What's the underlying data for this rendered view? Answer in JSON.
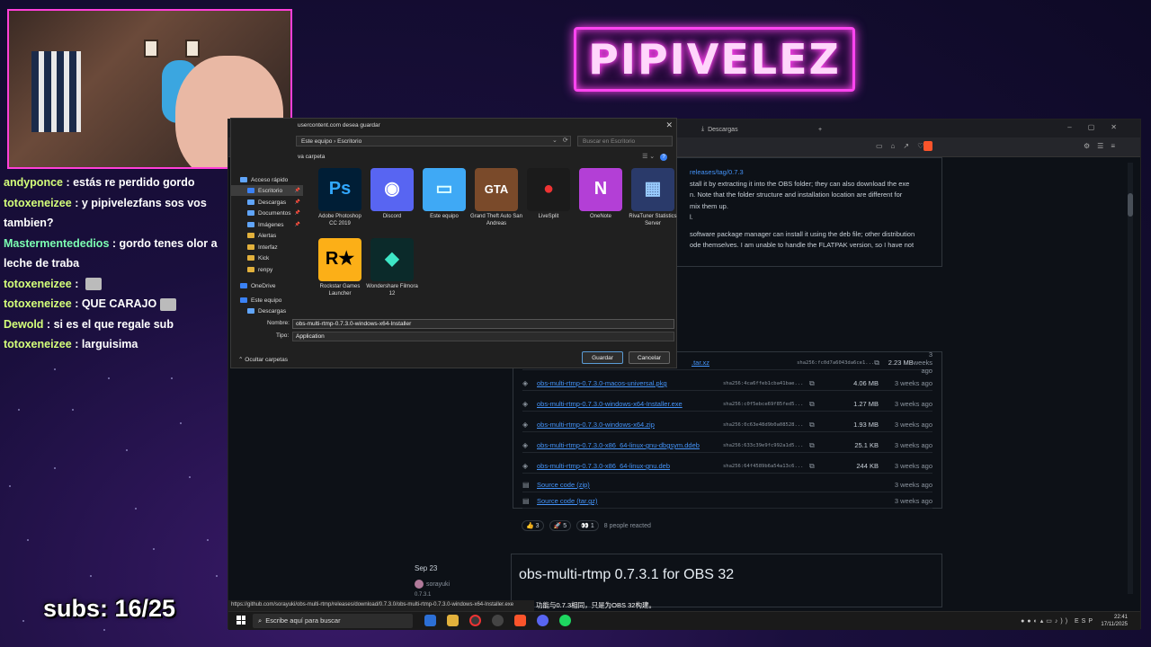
{
  "overlay": {
    "channel_name": "PIPIVELEZ",
    "subs_counter": "subs: 16/25"
  },
  "chat": [
    {
      "user": "andyponce",
      "color": "#d4ff7a",
      "text": "estás re perdido gordo"
    },
    {
      "user": "totoxeneizee",
      "color": "#d4ff7a",
      "text": "y pipivelezfans sos vos tambien?"
    },
    {
      "user": "Mastermentededios",
      "color": "#7cffb2",
      "text": "gordo tenes olor a leche de traba"
    },
    {
      "user": "totoxeneizee",
      "color": "#d4ff7a",
      "text": ""
    },
    {
      "user": "totoxeneizee",
      "color": "#d4ff7a",
      "text": "QUE CARAJO"
    },
    {
      "user": "Dewold",
      "color": "#d4ff7a",
      "text": "si es el que regale sub"
    },
    {
      "user": "totoxeneizee",
      "color": "#d4ff7a",
      "text": "larguisima"
    }
  ],
  "browser": {
    "tab_label": "Descargas",
    "release_link": "releases/tag/0.7.3",
    "notes": [
      "stall it by extracting it into the OBS folder; they can also download the exe",
      "n. Note that the folder structure and installation location are different for",
      "mix them up.",
      "l.",
      "software package manager can install it using the deb file; other distribution",
      "ode themselves. I am unable to handle the FLATPAK version, so I have not"
    ],
    "assets": [
      {
        "name": ".tar.xz",
        "sha": "sha256:fc0d7a6043da6ce1...",
        "size": "2.23 MB",
        "age": "3 weeks ago"
      },
      {
        "name": "obs-multi-rtmp-0.7.3.0-macos-universal.pkg",
        "sha": "sha256:4ca6ffeb1cba41bae...",
        "size": "4.06 MB",
        "age": "3 weeks ago"
      },
      {
        "name": "obs-multi-rtmp-0.7.3.0-windows-x64-Installer.exe",
        "sha": "sha256:c0f5ebce69f85fed5...",
        "size": "1.27 MB",
        "age": "3 weeks ago"
      },
      {
        "name": "obs-multi-rtmp-0.7.3.0-windows-x64.zip",
        "sha": "sha256:0c63e48d9b0a08528...",
        "size": "1.93 MB",
        "age": "3 weeks ago"
      },
      {
        "name": "obs-multi-rtmp-0.7.3.0-x86_64-linux-gnu-dbgsym.ddeb",
        "sha": "sha256:633c39e9fc992a1d5...",
        "size": "25.1 KB",
        "age": "3 weeks ago"
      },
      {
        "name": "obs-multi-rtmp-0.7.3.0-x86_64-linux-gnu.deb",
        "sha": "sha256:64f4589b6a54a13c6...",
        "size": "244 KB",
        "age": "3 weeks ago"
      },
      {
        "name": "Source code (zip)",
        "sha": "",
        "size": "",
        "age": "3 weeks ago"
      },
      {
        "name": "Source code (tar.gz)",
        "sha": "",
        "size": "",
        "age": "3 weeks ago"
      }
    ],
    "reactions": {
      "thumbs": "3",
      "rocket": "5",
      "heart": "1",
      "people": "8 people reacted"
    },
    "side_date": "Sep 23",
    "side_user": "sorayuki",
    "side_version": "0.7.3.1",
    "release2_title": "obs-multi-rtmp 0.7.3.1 for OBS 32",
    "status_url": "https://github.com/sorayuki/obs-multi-rtmp/releases/download/0.7.3.0/obs-multi-rtmp-0.7.3.0-windows-x64-Installer.exe",
    "chinese_note": "功能与0.7.3相同，只是为OBS 32构建。"
  },
  "dialog": {
    "title": "usercontent.com desea guardar",
    "path": [
      "Este equipo",
      "Escritorio"
    ],
    "search_placeholder": "Buscar en Escritorio",
    "new_folder": "va carpeta",
    "nav": [
      {
        "label": "Acceso rápido",
        "icon": "star"
      },
      {
        "label": "Escritorio",
        "icon": "desktop"
      },
      {
        "label": "Descargas",
        "icon": "download"
      },
      {
        "label": "Documentos",
        "icon": "doc"
      },
      {
        "label": "Imágenes",
        "icon": "pictures"
      },
      {
        "label": "Alertas",
        "icon": "folder"
      },
      {
        "label": "Interfaz",
        "icon": "folder"
      },
      {
        "label": "Kick",
        "icon": "folder"
      },
      {
        "label": "renpy",
        "icon": "folder"
      },
      {
        "label": "OneDrive",
        "icon": "cloud"
      },
      {
        "label": "Este equipo",
        "icon": "pc"
      },
      {
        "label": "Descargas",
        "icon": "download"
      }
    ],
    "files": [
      {
        "label": "Adobe Photoshop CC 2019",
        "glyph": "Ps",
        "color": "#001e36",
        "fg": "#31a8ff"
      },
      {
        "label": "Discord",
        "glyph": "◉",
        "color": "#5865f2",
        "fg": "#fff"
      },
      {
        "label": "Este equipo",
        "glyph": "▭",
        "color": "#3fa9f5",
        "fg": "#dff"
      },
      {
        "label": "Grand Theft Auto San Andreas",
        "glyph": "GTA",
        "color": "#7a4a2a",
        "fg": "#fff"
      },
      {
        "label": "LiveSplit",
        "glyph": "●",
        "color": "#1b1b1b",
        "fg": "#e33"
      },
      {
        "label": "OneNote",
        "glyph": "N",
        "color": "#b33fd6",
        "fg": "#fff"
      },
      {
        "label": "RivaTuner Statistics Server",
        "glyph": "▦",
        "color": "#2a3a6a",
        "fg": "#9cf"
      },
      {
        "label": "Rockstar Games Launcher",
        "glyph": "R★",
        "color": "#fcaf17",
        "fg": "#000"
      },
      {
        "label": "Wondershare Filmora 12",
        "glyph": "◆",
        "color": "#0b2a2a",
        "fg": "#3ee6c6"
      }
    ],
    "name_label": "Nombre:",
    "name_value": "obs-multi-rtmp-0.7.3.0-windows-x64-Installer",
    "type_label": "Tipo:",
    "type_value": "Application",
    "hide_folders": "Ocultar carpetas",
    "save": "Guardar",
    "cancel": "Cancelar"
  },
  "taskbar": {
    "search_placeholder": "Escribe aquí para buscar",
    "time": "22:41",
    "date": "17/11/2025"
  }
}
